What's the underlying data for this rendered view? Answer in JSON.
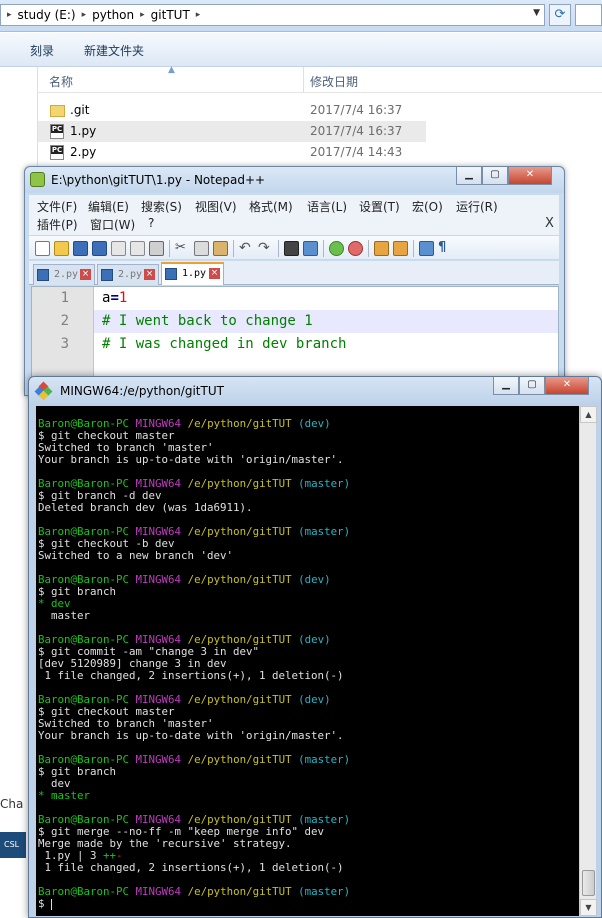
{
  "explorer": {
    "address": [
      "study (E:)",
      "python",
      "gitTUT"
    ],
    "toolbar": {
      "burn": "刻录",
      "new_folder": "新建文件夹"
    },
    "columns": {
      "name": "名称",
      "date": "修改日期"
    },
    "files": [
      {
        "name": ".git",
        "date": "2017/7/4 16:37",
        "type": "folder"
      },
      {
        "name": "1.py",
        "date": "2017/7/4 16:37",
        "type": "py"
      },
      {
        "name": "2.py",
        "date": "2017/7/4 14:43",
        "type": "py"
      }
    ],
    "nav_partial_text": "Cha",
    "nav_partial_icon": "CSL"
  },
  "notepad": {
    "title": "E:\\python\\gitTUT\\1.py - Notepad++",
    "menu_row1": [
      "文件(F)",
      "编辑(E)",
      "搜索(S)",
      "视图(V)",
      "格式(M)",
      "语言(L)",
      "设置(T)",
      "宏(O)",
      "运行(R)"
    ],
    "menu_row2": [
      "插件(P)",
      "窗口(W)",
      "?"
    ],
    "menu_close": "X",
    "tabs": [
      {
        "label": "2.py",
        "active": false
      },
      {
        "label": "2.py",
        "active": false
      },
      {
        "label": "1.py",
        "active": true
      }
    ],
    "line_numbers": [
      "1",
      "2",
      "3"
    ],
    "code": {
      "line1_var": "a",
      "line1_op": "=",
      "line1_num": "1",
      "line2": "# I went back to change 1",
      "line3": "# I was changed in dev branch"
    },
    "tab_close_glyph": "×"
  },
  "terminal": {
    "title": "MINGW64:/e/python/gitTUT",
    "prompt": {
      "user": "Baron@Baron-PC",
      "env": "MINGW64",
      "path": "/e/python/gitTUT"
    },
    "lines": [
      {
        "kind": "prompt",
        "branch": "(dev)"
      },
      {
        "kind": "text",
        "text": "$ git checkout master"
      },
      {
        "kind": "text",
        "text": "Switched to branch 'master'"
      },
      {
        "kind": "text",
        "text": "Your branch is up-to-date with 'origin/master'."
      },
      {
        "kind": "blank"
      },
      {
        "kind": "prompt",
        "branch": "(master)"
      },
      {
        "kind": "text",
        "text": "$ git branch -d dev"
      },
      {
        "kind": "text",
        "text": "Deleted branch dev (was 1da6911)."
      },
      {
        "kind": "blank"
      },
      {
        "kind": "prompt",
        "branch": "(master)"
      },
      {
        "kind": "text",
        "text": "$ git checkout -b dev"
      },
      {
        "kind": "text",
        "text": "Switched to a new branch 'dev'"
      },
      {
        "kind": "blank"
      },
      {
        "kind": "prompt",
        "branch": "(dev)"
      },
      {
        "kind": "text",
        "text": "$ git branch"
      },
      {
        "kind": "green",
        "text": "* dev"
      },
      {
        "kind": "text",
        "text": "  master"
      },
      {
        "kind": "blank"
      },
      {
        "kind": "prompt",
        "branch": "(dev)"
      },
      {
        "kind": "text",
        "text": "$ git commit -am \"change 3 in dev\""
      },
      {
        "kind": "text",
        "text": "[dev 5120989] change 3 in dev"
      },
      {
        "kind": "text",
        "text": " 1 file changed, 2 insertions(+), 1 deletion(-)"
      },
      {
        "kind": "blank"
      },
      {
        "kind": "prompt",
        "branch": "(dev)"
      },
      {
        "kind": "text",
        "text": "$ git checkout master"
      },
      {
        "kind": "text",
        "text": "Switched to branch 'master'"
      },
      {
        "kind": "text",
        "text": "Your branch is up-to-date with 'origin/master'."
      },
      {
        "kind": "blank"
      },
      {
        "kind": "prompt",
        "branch": "(master)"
      },
      {
        "kind": "text",
        "text": "$ git branch"
      },
      {
        "kind": "text",
        "text": "  dev"
      },
      {
        "kind": "green",
        "text": "* master"
      },
      {
        "kind": "blank"
      },
      {
        "kind": "prompt",
        "branch": "(master)"
      },
      {
        "kind": "text",
        "text": "$ git merge --no-ff -m \"keep merge info\" dev"
      },
      {
        "kind": "text",
        "text": "Merge made by the 'recursive' strategy."
      },
      {
        "kind": "stat",
        "text": " 1.py | 3 ",
        "plus": "++",
        "minus": "-"
      },
      {
        "kind": "text",
        "text": " 1 file changed, 2 insertions(+), 1 deletion(-)"
      },
      {
        "kind": "blank"
      },
      {
        "kind": "prompt",
        "branch": "(master)"
      },
      {
        "kind": "cursor",
        "text": "$ "
      }
    ]
  },
  "colors": {
    "term_green": "#19c419",
    "term_magenta": "#c03bc0",
    "term_yellow": "#c8c219",
    "term_cyan": "#25b6c7",
    "npp_comment": "#008000",
    "npp_number": "#ff0000"
  }
}
